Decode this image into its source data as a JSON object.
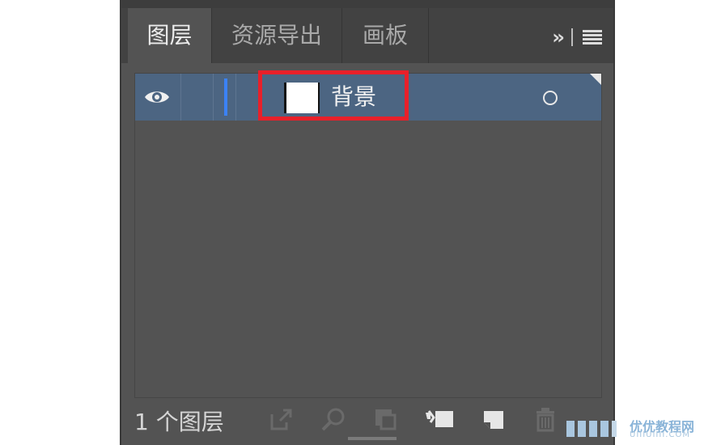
{
  "panel": {
    "tabs": [
      {
        "label": "图层",
        "active": true
      },
      {
        "label": "资源导出",
        "active": false
      },
      {
        "label": "画板",
        "active": false
      }
    ],
    "overflow_glyph": "››",
    "menu_icon": "hamburger-menu-icon"
  },
  "layers": [
    {
      "name": "背景",
      "visible": true,
      "color": "#3b82f6",
      "thumbnail_color": "#ffffff",
      "highlighted": true
    }
  ],
  "footer": {
    "layer_count_label": "1 个图层",
    "icons": [
      "export-icon",
      "locate-object-icon",
      "clipping-mask-icon",
      "new-sublayer-icon",
      "new-layer-icon",
      "trash-icon"
    ]
  },
  "watermark": {
    "text": "优优教程网",
    "sub": "UIIIUIIII.COM"
  },
  "colors": {
    "panel_bg": "#535353",
    "tab_bar_bg": "#424242",
    "selected_row": "#4c6582",
    "highlight_box": "#e8202a"
  }
}
